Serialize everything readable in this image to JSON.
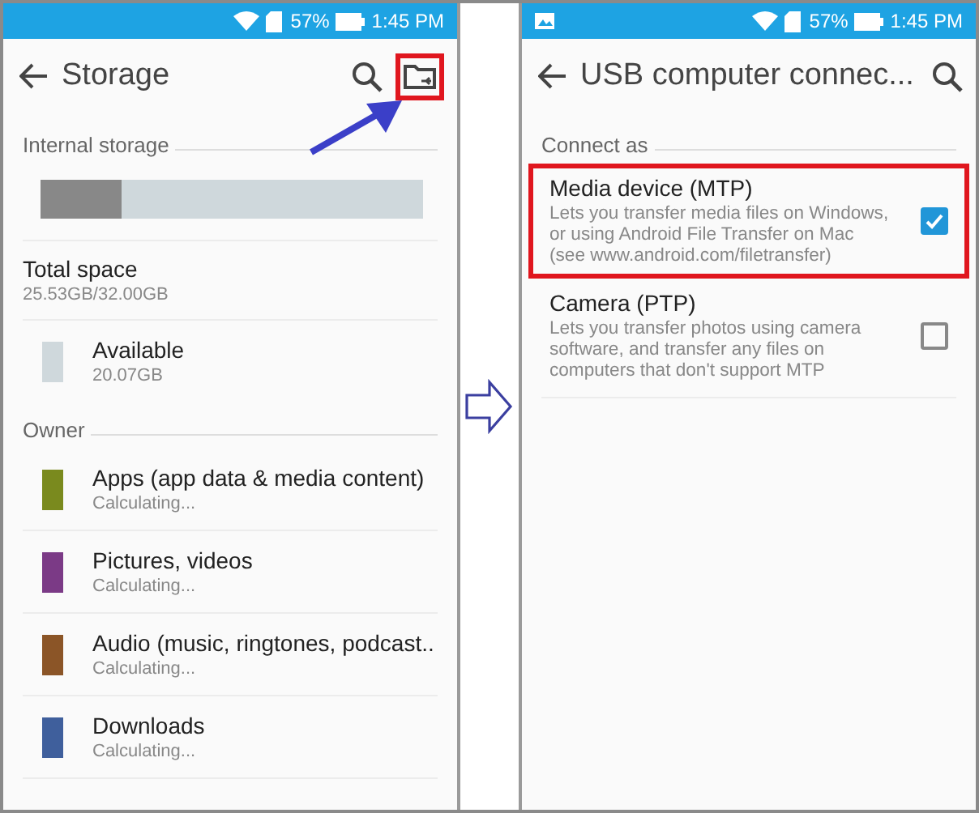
{
  "left_phone": {
    "status_bar": {
      "battery": "57%",
      "time": "1:45 PM"
    },
    "toolbar": {
      "title": "Storage",
      "usb_icon_highlighted": true
    },
    "internal_storage": {
      "header": "Internal storage",
      "level": 0.21
    },
    "total": {
      "title": "Total space",
      "value": "25.53GB/32.00GB"
    },
    "available": {
      "title": "Available",
      "value": "20.07GB",
      "color": "#cfd8dc"
    },
    "owner": {
      "header": "Owner",
      "items": [
        {
          "title": "Apps (app data & media content)",
          "value": "Calculating...",
          "color": "#7a8a1e"
        },
        {
          "title": "Pictures, videos",
          "value": "Calculating...",
          "color": "#7b3a86"
        },
        {
          "title": "Audio (music, ringtones, podcast..",
          "value": "Calculating...",
          "color": "#8b5527"
        },
        {
          "title": "Downloads",
          "value": "Calculating...",
          "color": "#3f5f9c"
        }
      ]
    }
  },
  "right_phone": {
    "status_bar": {
      "battery": "57%",
      "time": "1:45 PM"
    },
    "toolbar": {
      "title": "USB computer connec..."
    },
    "header": "Connect as",
    "options": [
      {
        "title": "Media device (MTP)",
        "description": "Lets you transfer media files on Windows, or using Android File Transfer on Mac (see www.android.com/filetransfer)",
        "checked": true,
        "highlighted": true
      },
      {
        "title": "Camera (PTP)",
        "description": "Lets you transfer photos using camera software, and transfer any files on computers that don't support MTP",
        "checked": false,
        "highlighted": false
      }
    ]
  }
}
